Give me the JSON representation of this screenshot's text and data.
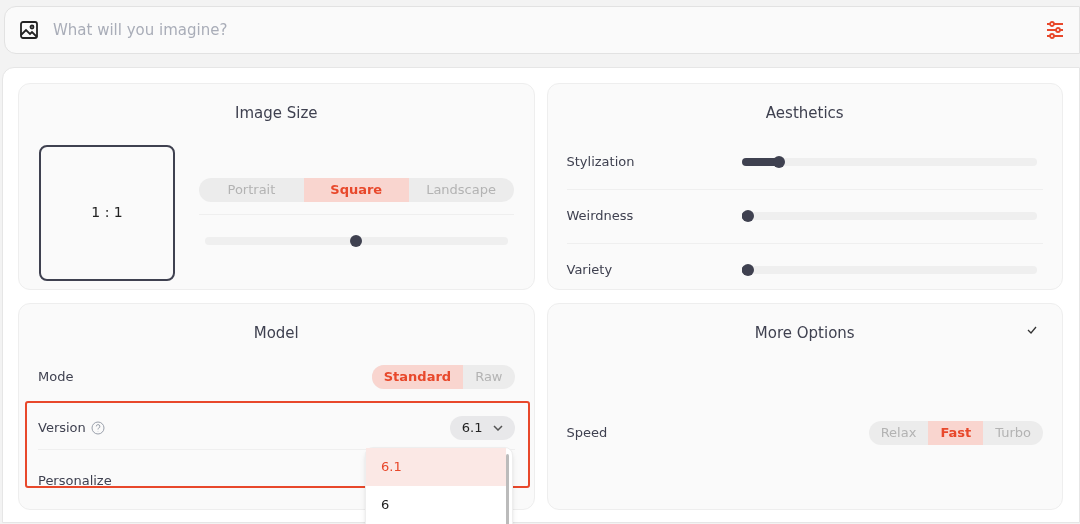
{
  "prompt_bar": {
    "placeholder": "What will you imagine?"
  },
  "image_size": {
    "title": "Image Size",
    "ratio": "1 : 1",
    "options": [
      {
        "label": "Portrait",
        "selected": false
      },
      {
        "label": "Square",
        "selected": true
      },
      {
        "label": "Landscape",
        "selected": false
      }
    ],
    "level": 0.5
  },
  "aesthetics": {
    "title": "Aesthetics",
    "sliders": [
      {
        "label": "Stylization",
        "level": 0.11
      },
      {
        "label": "Weirdness",
        "level": 0
      },
      {
        "label": "Variety",
        "level": 0
      }
    ]
  },
  "model": {
    "title": "Model",
    "mode": {
      "label": "Mode",
      "options": [
        {
          "label": "Standard",
          "selected": true
        },
        {
          "label": "Raw",
          "selected": false
        }
      ]
    },
    "version": {
      "label": "Version",
      "value": "6.1",
      "highlighted": true,
      "menu": [
        {
          "label": "6.1",
          "selected": true
        },
        {
          "label": "6",
          "selected": false
        }
      ]
    },
    "personalize": {
      "label": "Personalize"
    }
  },
  "more_options": {
    "title": "More Options",
    "checked": true,
    "speed": {
      "label": "Speed",
      "options": [
        {
          "label": "Relax",
          "selected": false
        },
        {
          "label": "Fast",
          "selected": true
        },
        {
          "label": "Turbo",
          "selected": false
        }
      ]
    }
  }
}
